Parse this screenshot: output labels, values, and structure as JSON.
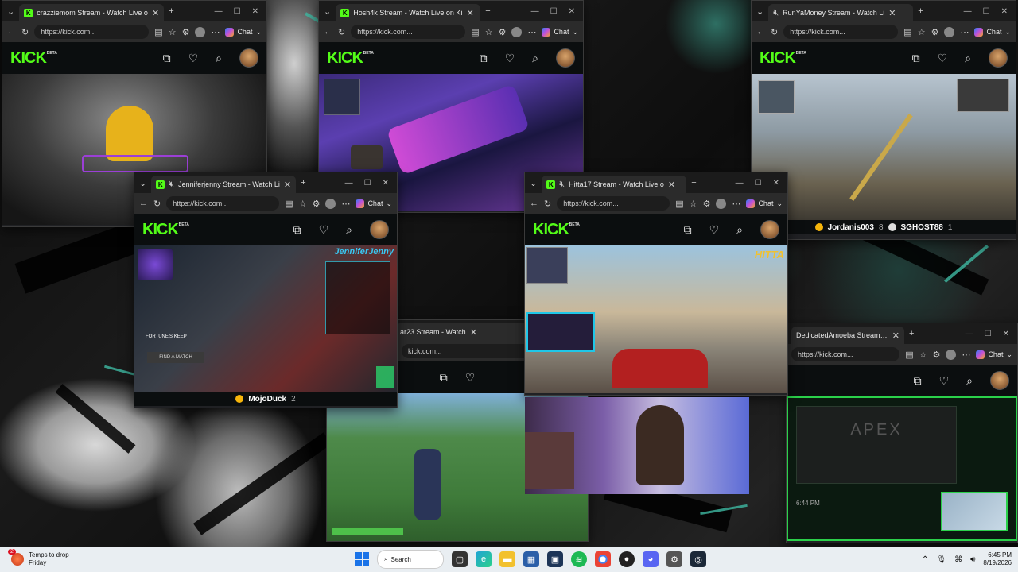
{
  "windows": [
    {
      "id": "w1",
      "tab_title": "crazziemom Stream - Watch Live o",
      "url": "https://kick.com...",
      "has_chat": false
    },
    {
      "id": "w2",
      "tab_title": "Hosh4k Stream - Watch Live on Ki",
      "url": "https://kick.com...",
      "has_chat": true
    },
    {
      "id": "w3",
      "tab_title": "RunYaMoney Stream - Watch Li",
      "url": "https://kick.com...",
      "has_chat": true,
      "footer": {
        "user1": "Jordanis003",
        "count1": "8",
        "user2": "SGHOST88",
        "count2": "1"
      }
    },
    {
      "id": "w4",
      "tab_title": "Jenniferjenny Stream - Watch Li",
      "url": "https://kick.com...",
      "has_chat": true,
      "footer": {
        "user1": "MojoDuck",
        "count1": "2"
      }
    },
    {
      "id": "w5",
      "tab_title": "Hitta17 Stream - Watch Live o",
      "url": "https://kick.com...",
      "has_chat": true
    },
    {
      "id": "w6",
      "tab_title": "ar23 Stream - Watch",
      "url": "kick.com..."
    },
    {
      "id": "w7",
      "tab_title": "DedicatedAmoeba Stream - W",
      "url": "https://kick.com...",
      "has_chat": true
    }
  ],
  "common": {
    "chat_label": "Chat",
    "kick_logo": "KICK",
    "beta": "BETA"
  },
  "overlays": {
    "stream_tag_w4": "JenniferJenny",
    "stream_tag_w5": "HITTA",
    "fortune": "FORTUNE'S KEEP",
    "find_match": "FIND A MATCH",
    "apex_text": "APEX",
    "time_w7": "6:44 PM"
  },
  "taskbar": {
    "weather_line1": "Temps to drop",
    "weather_line2": "Friday",
    "weather_badge": "2",
    "search_label": "Search",
    "time": "6:45 PM",
    "date": "8/19/2026"
  }
}
